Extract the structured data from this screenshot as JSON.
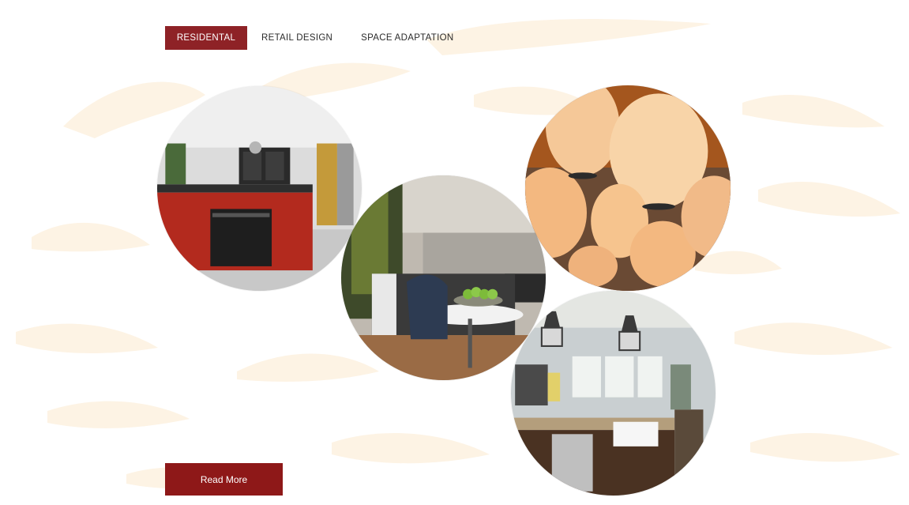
{
  "tabs": [
    {
      "label": "RESIDENTAL",
      "active": true
    },
    {
      "label": "RETAIL DESIGN",
      "active": false
    },
    {
      "label": "SPACE ADAPTATION",
      "active": false
    }
  ],
  "gallery": {
    "images": [
      {
        "depicts": "kitchen-red-island"
      },
      {
        "depicts": "kitchen-round-table-apples"
      },
      {
        "depicts": "pendant-lamps"
      },
      {
        "depicts": "kitchen-granite-island-lanterns"
      }
    ]
  },
  "cta": {
    "read_more_label": "Read More"
  },
  "colors": {
    "accent": "#8e2226",
    "button": "#8e1818",
    "pattern": "#fdf3e4"
  }
}
